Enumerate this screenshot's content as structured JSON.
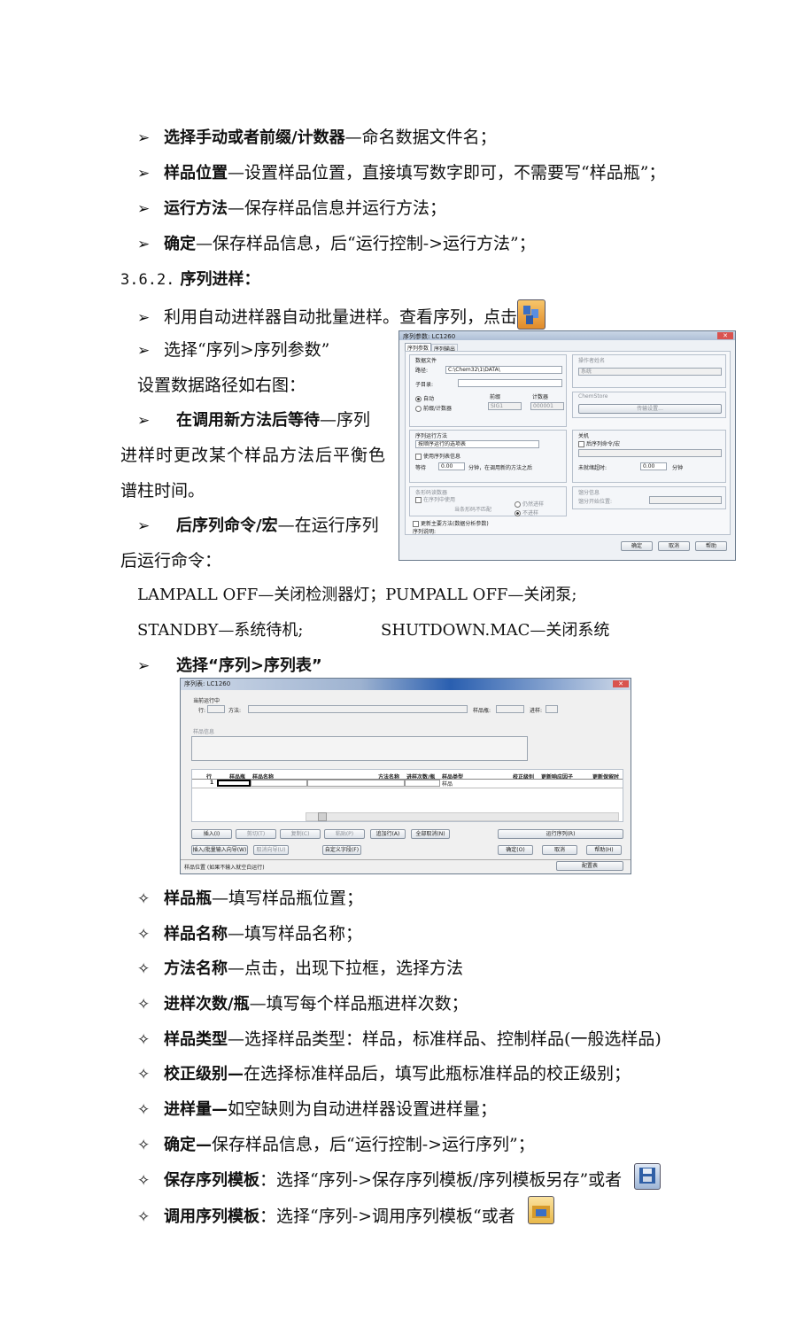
{
  "bullets_top": [
    {
      "term": "选择手动或者前缀/计数器",
      "desc": "—命名数据文件名；"
    },
    {
      "term": "样品位置",
      "desc": "—设置样品位置，直接填写数字即可，不需要写“样品瓶”；"
    },
    {
      "term": "运行方法",
      "desc": "—保存样品信息并运行方法；"
    },
    {
      "term": "确定",
      "desc": "—保存样品信息，后“运行控制->运行方法”；"
    }
  ],
  "section_title": {
    "num": "3.6.2.",
    "label": "序列进样："
  },
  "seq_intro": "利用自动进样器自动批量进样。查看序列，点击",
  "seq_param_select": "选择“序列>序列参数”",
  "seq_param_note": "设置数据路径如右图：",
  "wait_term": "在调用新方法后等待",
  "wait_desc_1": "—序列",
  "wait_desc_2": "进样时更改某个样品方法后平衡色",
  "wait_desc_3": "谱柱时间。",
  "post_term": "后序列命令/宏",
  "post_desc_1": "—在运行序列",
  "post_desc_2": "后运行命令：",
  "cmd_line_1": "LAMPALL OFF—关闭检测器灯；PUMPALL OFF—关闭泵;",
  "cmd_standby": "STANDBY—系统待机;",
  "cmd_shutdown": "SHUTDOWN.MAC—关闭系统",
  "seq_table_select": "选择“序列>序列表”",
  "dialog_params": {
    "title": "序列参数: LC1260",
    "tabs": [
      "序列参数",
      "序列输出"
    ],
    "data_file": "数据文件",
    "path_label": "路径:",
    "path_value": "C:\\Chem32\\1\\DATA\\",
    "subdir_label": "子目录:",
    "auto_label": "自动",
    "prefix_label": "前缀/计数器",
    "prefix_header": "前缀",
    "counter_header": "计数器",
    "prefix_value": "SIG1",
    "counter_value": "000001",
    "operator_group": "操作者姓名",
    "operator_value": "系统",
    "chemstore_group": "ChemStore",
    "chemstore_button": "传输设置...",
    "run_mode_group": "序列运行方法",
    "run_mode_value": "按顺序运行的选项表",
    "use_seq_info": "使用序列表信息",
    "wait_label": "等待",
    "wait_value": "0.00",
    "wait_unit": "分钟，在调用新的方法之后",
    "shutdown_group": "关机",
    "post_cmd_label": "后序列命令/宏",
    "not_ready_label": "未就绪超时:",
    "not_ready_value": "0.00",
    "not_ready_unit": "分钟",
    "barcode_group": "条形码读数器",
    "barcode_use": "在序列中使用",
    "barcode_mismatch": "当条形码不匹配",
    "barcode_opt1": "仍然进样",
    "barcode_opt2": "不进样",
    "fraction_group": "馏分信息",
    "fraction_start": "馏分开始位置:",
    "update_method": "更新主要方法(数据分析参数)",
    "seq_comment": "序列说明:",
    "ok": "确定",
    "cancel": "取消",
    "help": "帮助"
  },
  "dialog_table": {
    "title": "序列表: LC1260",
    "current_run": "当前运行中",
    "row_label": "行:",
    "method_label": "方法:",
    "vial_label": "样品瓶:",
    "inj_label": "进样:",
    "sample_info": "样品信息",
    "columns": [
      "行",
      "样品瓶",
      "样品名称",
      "方法名称",
      "进样次数/瓶",
      "样品类型",
      "校正级别",
      "更新响应因子",
      "更新保留时"
    ],
    "row1": {
      "num": "1",
      "type": "样品"
    },
    "btn_insert": "插入(I)",
    "btn_cut": "剪切(T)",
    "btn_copy": "复制(C)",
    "btn_paste": "粘贴(P)",
    "btn_append": "追加行(A)",
    "btn_clear_all": "全部取消(N)",
    "btn_run_seq": "运行序列(R)",
    "btn_wizard": "插入/批量输入向导(W)",
    "btn_undo": "取消向导(U)",
    "btn_custom": "自定义字段(F)",
    "btn_ok": "确定(O)",
    "btn_cancel": "取消",
    "btn_help": "帮助(H)",
    "status": "样品位置 (如果不输入就空白运行)",
    "btn_config": "配置表"
  },
  "bullets_bottom": [
    {
      "term": "样品瓶",
      "desc": "—填写样品瓶位置；"
    },
    {
      "term": "样品名称",
      "desc": "—填写样品名称；"
    },
    {
      "term": "方法名称",
      "desc": "—点击，出现下拉框，选择方法"
    },
    {
      "term": "进样次数/瓶",
      "desc": "—填写每个样品瓶进样次数；"
    },
    {
      "term": "样品类型",
      "desc": "—选择样品类型：样品，标准样品、控制样品(一般选样品)"
    },
    {
      "term": "校正级别—",
      "desc": "在选择标准样品后，填写此瓶标准样品的校正级别；"
    },
    {
      "term": "进样量—",
      "desc": "如空缺则为自动进样器设置进样量；"
    },
    {
      "term": "确定—",
      "desc": "保存样品信息，后“运行控制->运行序列”；"
    },
    {
      "term": "保存序列模板",
      "desc": "：选择“序列->保存序列模板/序列模板另存”或者"
    },
    {
      "term": "调用序列模板",
      "desc": "：选择“序列->调用序列模板“或者"
    }
  ]
}
